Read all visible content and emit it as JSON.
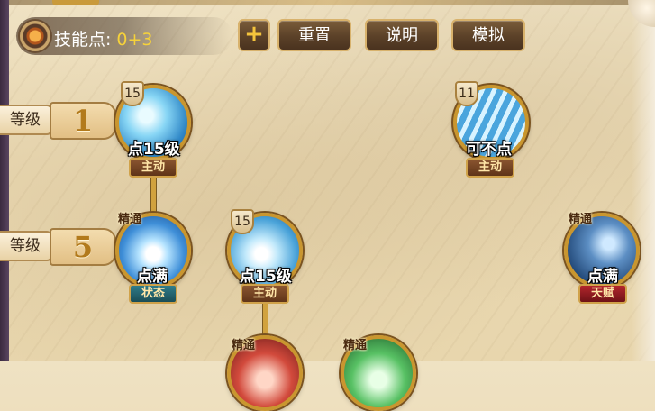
{
  "toolbar": {
    "skill_points_label": "技能点:",
    "skill_points_value": "0+3",
    "plus_label": "+",
    "reset_label": "重置",
    "help_label": "说明",
    "simulate_label": "模拟",
    "icon": "skill-point-coin-icon"
  },
  "levels": [
    {
      "label": "等级",
      "number": "1"
    },
    {
      "label": "等级",
      "number": "5"
    }
  ],
  "skills": [
    {
      "level_badge": "15",
      "mastery": "",
      "text": "点15级",
      "type": "主动",
      "icon": "water-wave-icon"
    },
    {
      "level_badge": "11",
      "mastery": "",
      "text": "可不点",
      "type": "主动",
      "icon": "water-claw-icon"
    },
    {
      "level_badge": "",
      "mastery": "精通",
      "text": "点满",
      "type": "状态",
      "icon": "light-burst-icon"
    },
    {
      "level_badge": "15",
      "mastery": "",
      "text": "点15级",
      "type": "主动",
      "icon": "ice-wave-icon"
    },
    {
      "level_badge": "",
      "mastery": "精通",
      "text": "点满",
      "type": "天赋",
      "icon": "ninja-strike-icon"
    },
    {
      "level_badge": "",
      "mastery": "精通",
      "text": "",
      "type": "",
      "icon": "red-skill-icon"
    },
    {
      "level_badge": "",
      "mastery": "精通",
      "text": "",
      "type": "",
      "icon": "green-skill-icon"
    }
  ],
  "colors": {
    "gold_border": "#c9962f",
    "points_value": "#f6d23a",
    "badge_active": "#8a5530",
    "badge_status": "#2f7c8a",
    "badge_talent": "#b3262c"
  }
}
